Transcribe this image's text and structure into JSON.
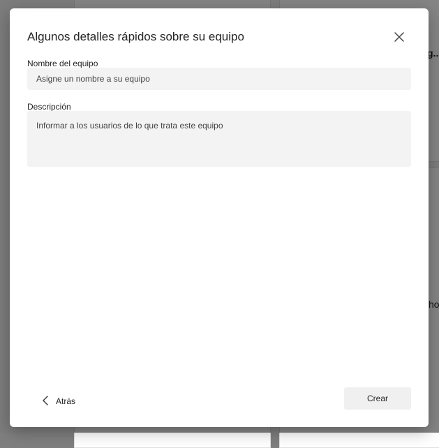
{
  "dialog": {
    "title": "Algunos detalles rápidos sobre su equipo",
    "close_icon": "close-icon",
    "team_name": {
      "label": "Nombre del equipo",
      "placeholder": "Asigne un nombre a su equipo",
      "value": ""
    },
    "description": {
      "label": "Descripción",
      "placeholder": "Informar a los usuarios de lo que trata este equipo",
      "value": ""
    },
    "back_label": "Atrás",
    "back_icon": "chevron-left-icon",
    "create_label": "Crear"
  },
  "background": {
    "partial_text_1": "g...",
    "partial_text_2": "ho"
  }
}
